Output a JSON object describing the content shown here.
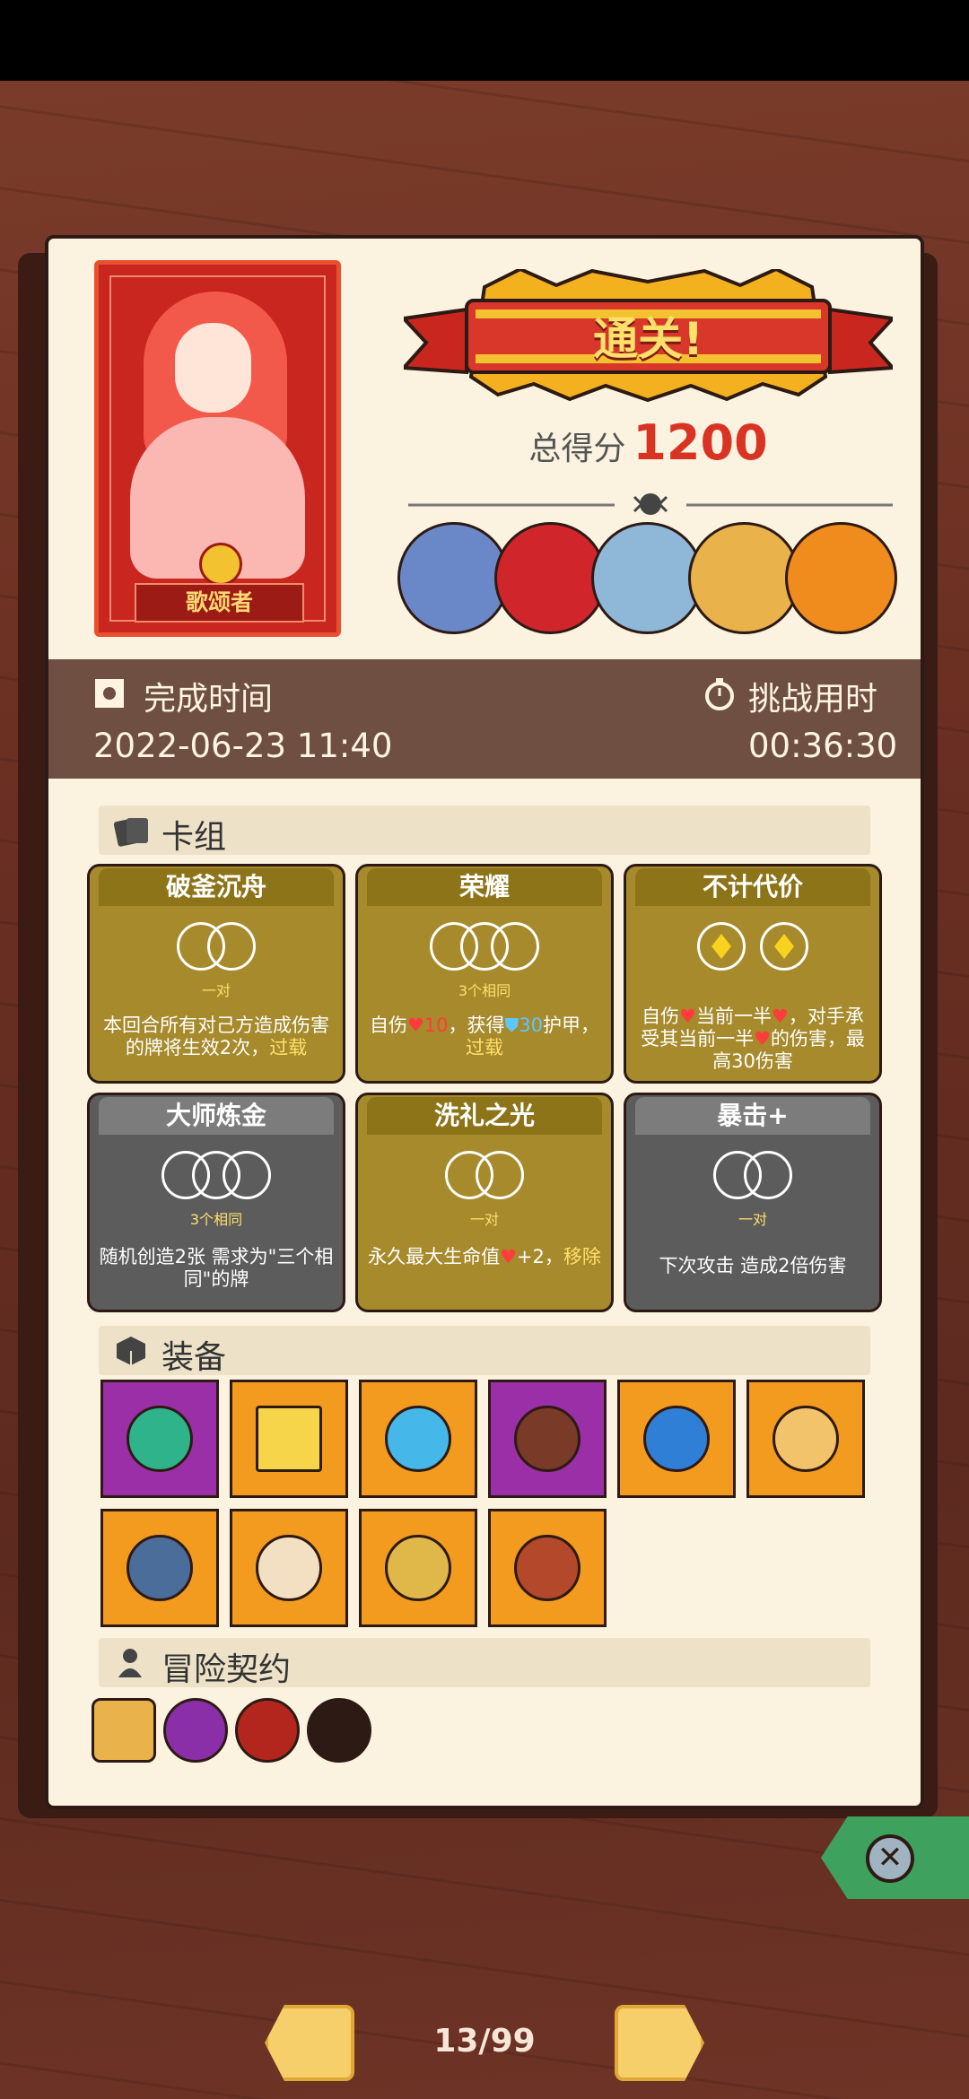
{
  "result": {
    "banner": "通关!",
    "score_label": "总得分",
    "score_value": "1200"
  },
  "hero": {
    "name": "歌颂者"
  },
  "time": {
    "finish_label": "完成时间",
    "finish_value": "2022-06-23 11:40",
    "duration_label": "挑战用时",
    "duration_value": "00:36:30"
  },
  "deck": {
    "title": "卡组",
    "cards": [
      {
        "name": "破釜沉舟",
        "tag": "一对",
        "desc_pre": "本回合所有对己方造成伤害的牌将生效2次，",
        "desc_hl": "过载"
      },
      {
        "name": "荣耀",
        "tag": "3个相同",
        "d1": "自伤",
        "d2": "10",
        "d3": "，获得",
        "d4": "30",
        "d5": "护甲，",
        "d6": "过载"
      },
      {
        "name": "不计代价",
        "desc": "自伤",
        "desc2": "当前一半",
        "desc3": "，对手承受其当前一半",
        "desc4": "的伤害，最高30伤害"
      },
      {
        "name": "大师炼金",
        "tag": "3个相同",
        "desc": "随机创造2张 需求为\"三个相同\"的牌"
      },
      {
        "name": "洗礼之光",
        "tag": "一对",
        "desc": "永久最大生命值",
        "desc2": "+2，",
        "desc3": "移除"
      },
      {
        "name": "暴击+",
        "tag": "一对",
        "desc": "下次攻击 造成2倍伤害"
      }
    ]
  },
  "equipment": {
    "title": "装备"
  },
  "contract": {
    "title": "冒险契约"
  },
  "pager": {
    "text": "13/99"
  },
  "colors": {
    "accent_red": "#d93324",
    "gold": "#a68a2c",
    "gray": "#5c5c5c",
    "panel": "#fbf3df"
  }
}
